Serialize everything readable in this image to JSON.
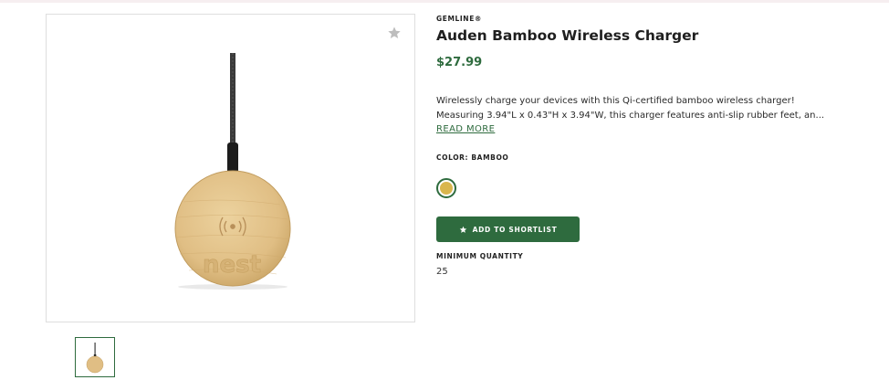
{
  "product": {
    "brand": "GEMLINE®",
    "title": "Auden Bamboo Wireless Charger",
    "price": "$27.99",
    "description_lines": [
      "Wirelessly charge your devices with this Qi-certified bamboo wireless charger!",
      "Measuring 3.94\"L x 0.43\"H x 3.94\"W, this charger features anti-slip rubber feet, an..."
    ],
    "read_more_label": "READ MORE",
    "color_label": "COLOR: BAMBOO",
    "selected_color": "#d9b64e",
    "shortlist_button_label": "ADD TO SHORTLIST",
    "minimum_quantity_label": "MINIMUM QUANTITY",
    "minimum_quantity_value": "25"
  },
  "gallery": {
    "image_logo_text": "nest",
    "favorite_icon": "star-icon",
    "thumbnail_count": 1
  },
  "colors": {
    "accent": "#2e6b3e",
    "bamboo": "#e0be84",
    "star_inactive": "#bdbdbd"
  }
}
